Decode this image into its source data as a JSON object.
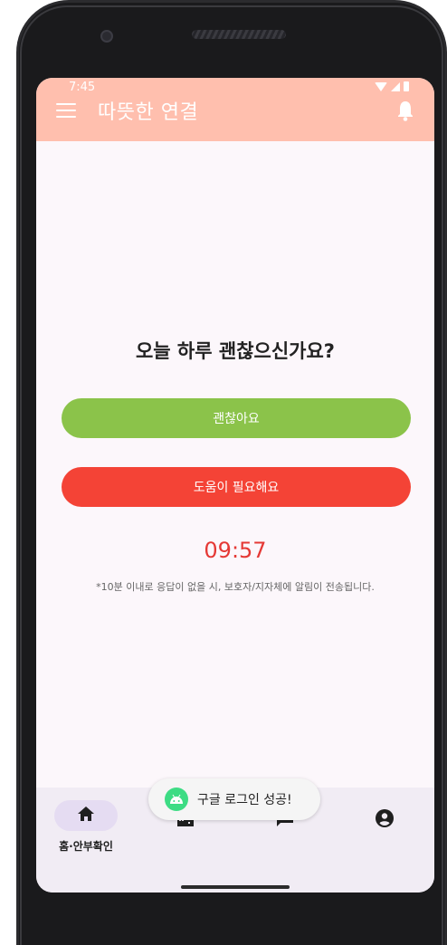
{
  "status_bar": {
    "time": "7:45"
  },
  "app_bar": {
    "title": "따뜻한 연결"
  },
  "main": {
    "question": "오늘 하루 괜찮으신가요?",
    "ok_button": "괜찮아요",
    "help_button": "도움이 필요해요",
    "timer": "09:57",
    "notice": "*10분 이내로 응답이 없을 시, 보호자/지자체에 알림이 전송됩니다."
  },
  "toast": {
    "text": "구글 로그인 성공!"
  },
  "bottom_nav": {
    "items": [
      {
        "label": "홈·안부확인",
        "icon": "home-icon",
        "active": true
      },
      {
        "label": "",
        "icon": "building-icon",
        "active": false
      },
      {
        "label": "",
        "icon": "chat-icon",
        "active": false
      },
      {
        "label": "",
        "icon": "account-icon",
        "active": false
      }
    ]
  },
  "colors": {
    "app_bar": "#ffbfae",
    "ok_button": "#8bc34a",
    "help_button": "#f44336",
    "timer": "#e53935",
    "background": "#fcf7fb",
    "nav_background": "#f1ecf4",
    "nav_active_pill": "#e5dcf2"
  }
}
